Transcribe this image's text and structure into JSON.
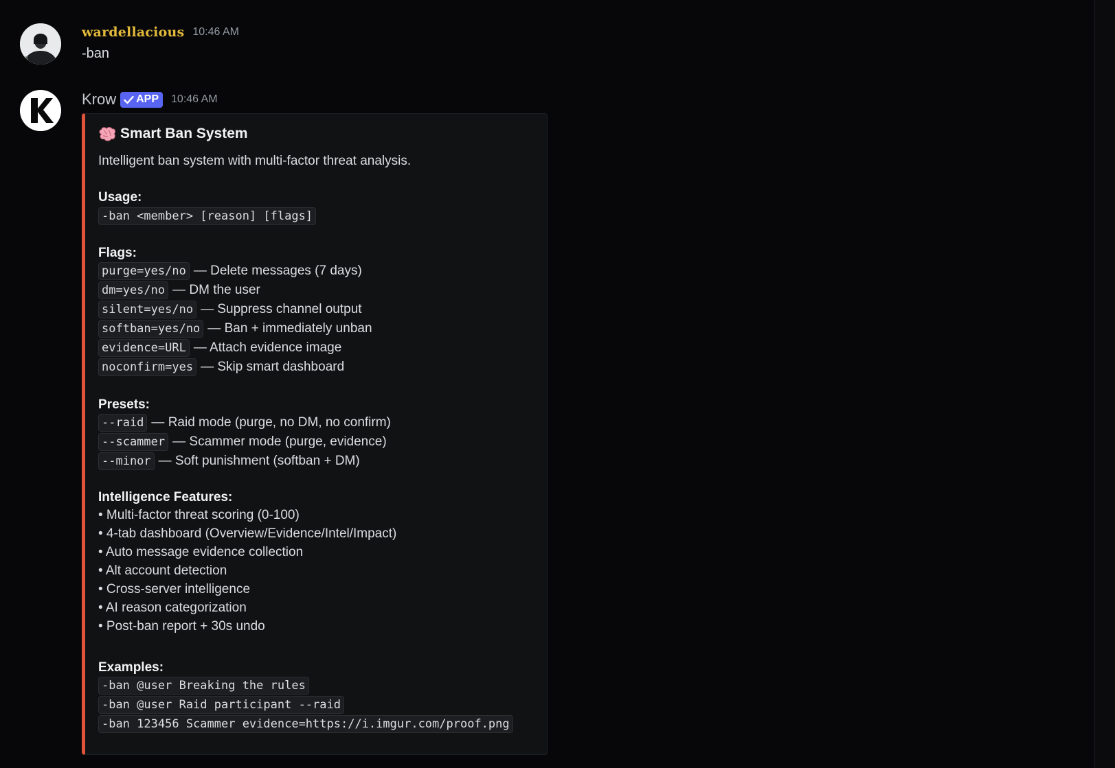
{
  "messages": {
    "user": {
      "name": "wardellacious",
      "time": "10:46 AM",
      "text": "-ban"
    },
    "bot": {
      "name": "Krow",
      "badge": "APP",
      "time": "10:46 AM"
    }
  },
  "embed": {
    "accent_color": "#e0533b",
    "title": "Smart Ban System",
    "description": "Intelligent ban system with multi-factor threat analysis.",
    "usage": {
      "heading": "Usage:",
      "code": "-ban <member> [reason] [flags]"
    },
    "flags": {
      "heading": "Flags:",
      "items": [
        {
          "code": "purge=yes/no",
          "desc": "— Delete messages (7 days)"
        },
        {
          "code": "dm=yes/no",
          "desc": "— DM the user"
        },
        {
          "code": "silent=yes/no",
          "desc": "— Suppress channel output"
        },
        {
          "code": "softban=yes/no",
          "desc": "— Ban + immediately unban"
        },
        {
          "code": "evidence=URL",
          "desc": "— Attach evidence image"
        },
        {
          "code": "noconfirm=yes",
          "desc": "— Skip smart dashboard"
        }
      ]
    },
    "presets": {
      "heading": "Presets:",
      "items": [
        {
          "code": "--raid",
          "desc": "— Raid mode (purge, no DM, no confirm)"
        },
        {
          "code": "--scammer",
          "desc": "— Scammer mode (purge, evidence)"
        },
        {
          "code": "--minor",
          "desc": "— Soft punishment (softban + DM)"
        }
      ]
    },
    "features": {
      "heading": "Intelligence Features:",
      "items": [
        "• Multi-factor threat scoring (0-100)",
        "• 4-tab dashboard (Overview/Evidence/Intel/Impact)",
        "• Auto message evidence collection",
        "• Alt account detection",
        "• Cross-server intelligence",
        "• AI reason categorization",
        "• Post-ban report + 30s undo"
      ]
    },
    "examples": {
      "heading": "Examples:",
      "items": [
        "-ban @user Breaking the rules",
        "-ban @user Raid participant --raid",
        "-ban 123456 Scammer evidence=https://i.imgur.com/proof.png"
      ]
    }
  }
}
